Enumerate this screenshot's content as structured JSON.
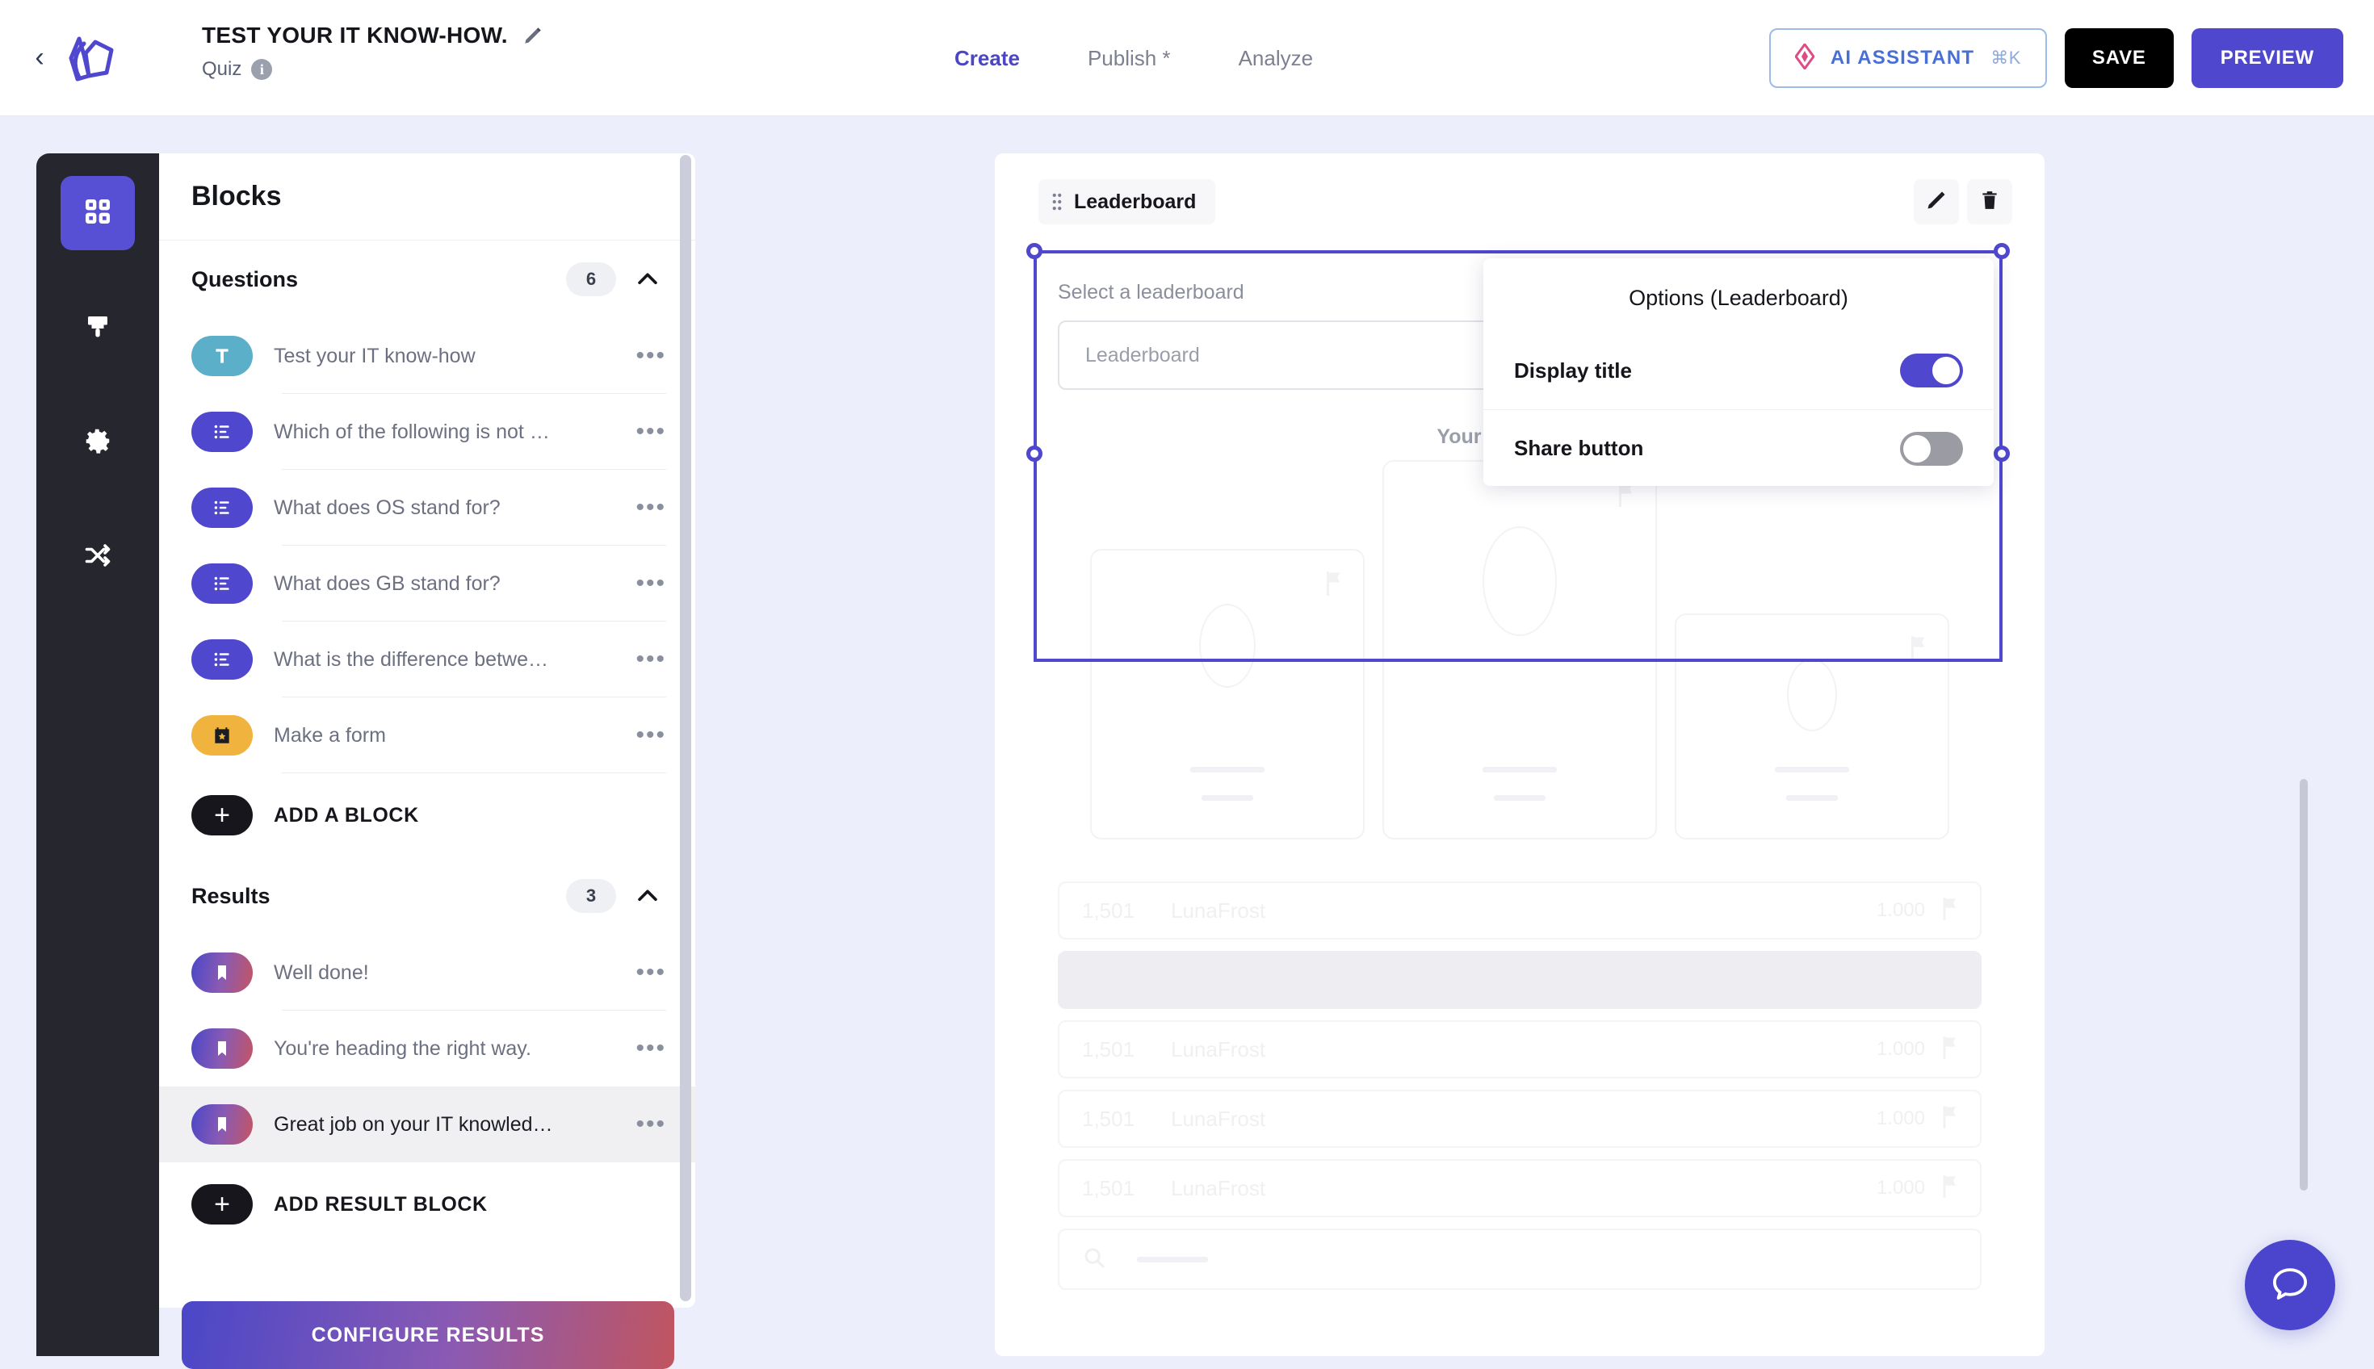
{
  "header": {
    "back_icon": "chevron-left-icon",
    "logo": "brand-logo",
    "title": "TEST YOUR IT KNOW-HOW.",
    "edit_icon": "pencil-icon",
    "subtype": "Quiz",
    "info_icon": "info-icon",
    "info_glyph": "i",
    "nav": [
      {
        "label": "Create",
        "active": true
      },
      {
        "label": "Publish *",
        "active": false
      },
      {
        "label": "Analyze",
        "active": false
      }
    ],
    "ai_button": {
      "label": "AI ASSISTANT",
      "shortcut": "⌘K",
      "icon": "ai-diamond-icon"
    },
    "save_label": "SAVE",
    "preview_label": "PREVIEW"
  },
  "rail": {
    "items": [
      {
        "name": "blocks",
        "icon": "grid-icon",
        "active": true
      },
      {
        "name": "design",
        "icon": "paintbrush-icon",
        "active": false
      },
      {
        "name": "settings",
        "icon": "gear-icon",
        "active": false
      },
      {
        "name": "logic",
        "icon": "share-nodes-icon",
        "active": false
      }
    ]
  },
  "panel": {
    "title": "Blocks",
    "sections": [
      {
        "name": "Questions",
        "count": "6",
        "collapse_icon": "chevron-up-icon",
        "items": [
          {
            "label": "Test your IT know-how",
            "icon": "text-block-icon",
            "kind": "text",
            "selected": false
          },
          {
            "label": "Which of the following is not …",
            "icon": "choice-block-icon",
            "kind": "choice",
            "selected": false
          },
          {
            "label": "What does OS stand for?",
            "icon": "choice-block-icon",
            "kind": "choice",
            "selected": false
          },
          {
            "label": "What does GB stand for?",
            "icon": "choice-block-icon",
            "kind": "choice",
            "selected": false
          },
          {
            "label": "What is the difference betwe…",
            "icon": "choice-block-icon",
            "kind": "choice",
            "selected": false
          },
          {
            "label": "Make a form",
            "icon": "form-block-icon",
            "kind": "form",
            "selected": false
          }
        ],
        "add_label": "ADD A BLOCK"
      },
      {
        "name": "Results",
        "count": "3",
        "collapse_icon": "chevron-up-icon",
        "items": [
          {
            "label": "Well done!",
            "icon": "result-block-icon",
            "kind": "result",
            "selected": false
          },
          {
            "label": "You're heading the right way.",
            "icon": "result-block-icon",
            "kind": "result",
            "selected": false
          },
          {
            "label": "Great job on your IT knowled…",
            "icon": "result-block-icon",
            "kind": "result",
            "selected": true
          }
        ],
        "add_label": "ADD RESULT BLOCK"
      }
    ],
    "configure_results_label": "CONFIGURE RESULTS",
    "overflow_glyph": "•••"
  },
  "canvas": {
    "block_chip": {
      "label": "Leaderboard",
      "grip_icon": "drag-grip-icon"
    },
    "actions": [
      {
        "name": "edit",
        "icon": "pencil-icon"
      },
      {
        "name": "delete",
        "icon": "trash-icon"
      }
    ],
    "leaderboard": {
      "select_label": "Select a leaderboard",
      "select_value": "Leaderboard",
      "your_leaderboard_label": "Your leaderboard",
      "podium": [
        {
          "place": "2",
          "size": "medium"
        },
        {
          "place": "1",
          "size": "large"
        },
        {
          "place": "3",
          "size": "small"
        }
      ],
      "columns": [
        "rank",
        "name",
        "score",
        "flag"
      ],
      "rows": [
        {
          "rank": "1,501",
          "name": "LunaFrost",
          "score": "1.000",
          "flag_icon": "flag-icon",
          "highlight": false
        },
        {
          "rank": "",
          "name": "",
          "score": "",
          "flag_icon": "",
          "highlight": true
        },
        {
          "rank": "1,501",
          "name": "LunaFrost",
          "score": "1.000",
          "flag_icon": "flag-icon",
          "highlight": false
        },
        {
          "rank": "1,501",
          "name": "LunaFrost",
          "score": "1.000",
          "flag_icon": "flag-icon",
          "highlight": false
        },
        {
          "rank": "1,501",
          "name": "LunaFrost",
          "score": "1.000",
          "flag_icon": "flag-icon",
          "highlight": false
        }
      ],
      "search_icon": "search-icon"
    }
  },
  "options_popover": {
    "title": "Options (Leaderboard)",
    "rows": [
      {
        "label": "Display title",
        "state": "on"
      },
      {
        "label": "Share button",
        "state": "off"
      }
    ]
  },
  "chat": {
    "icon": "chat-bubble-icon"
  },
  "colors": {
    "accent": "#4f48cf",
    "page_bg": "#eceefb",
    "rail_bg": "#26262f",
    "text_dark": "#15161c",
    "text_muted": "#6c7080",
    "ai_border": "#9dbbe6",
    "ai_text": "#4a6fd4",
    "toggle_off": "#9b9ba3"
  }
}
